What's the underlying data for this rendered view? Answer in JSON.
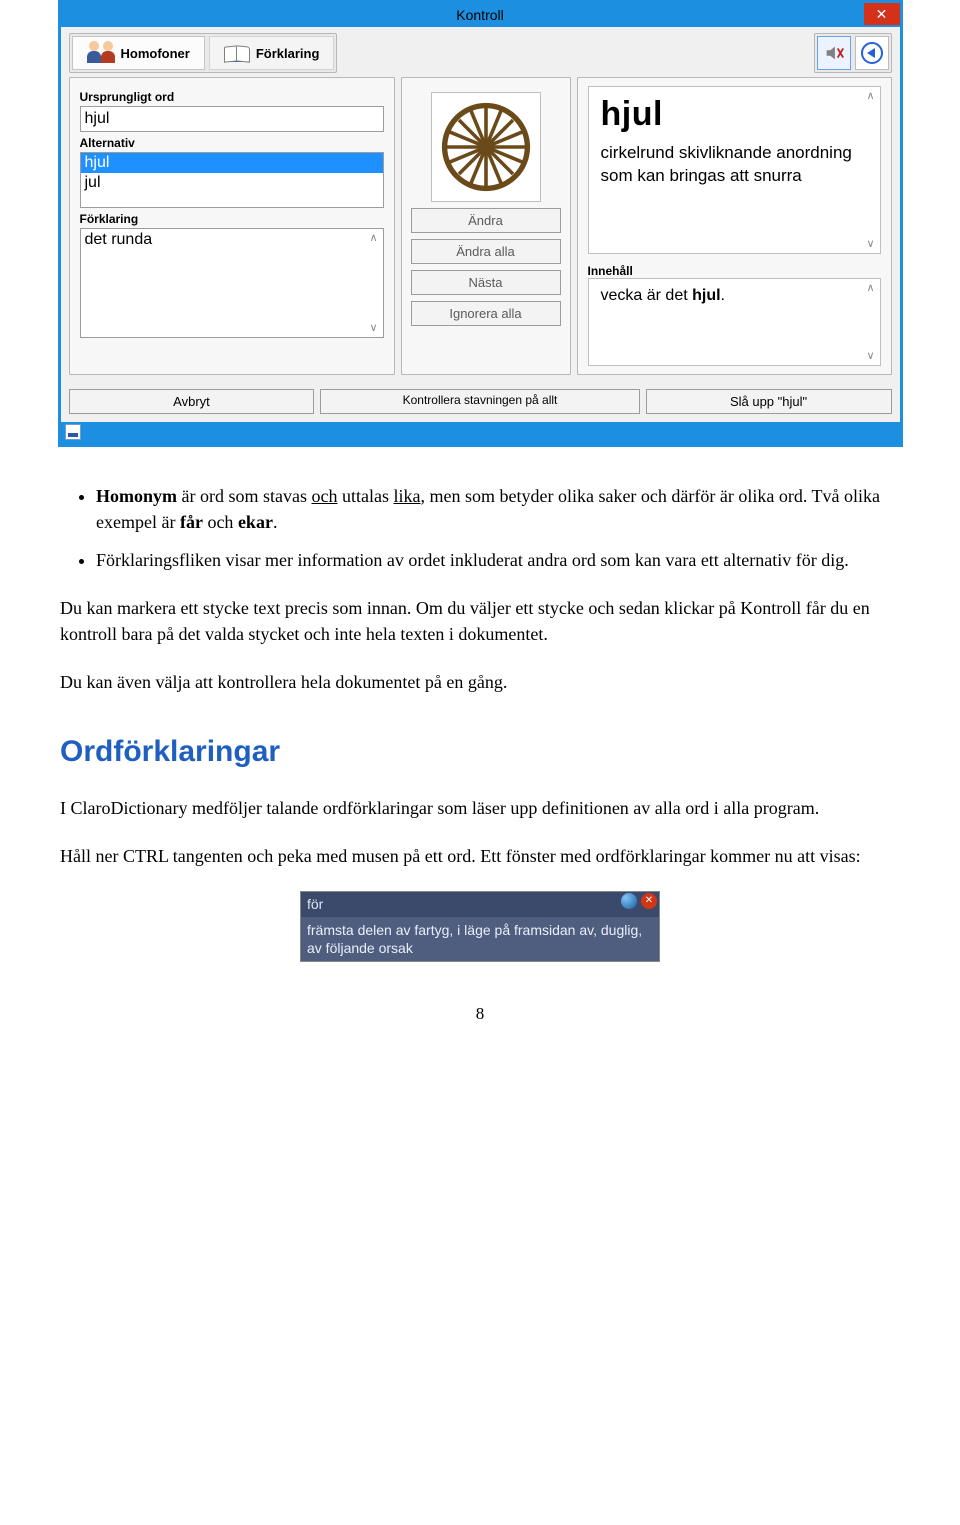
{
  "dialog": {
    "title": "Kontroll",
    "tabs": {
      "homofoner": "Homofoner",
      "forklaring": "Förklaring"
    },
    "labels": {
      "ursprungligt": "Ursprungligt ord",
      "alternativ": "Alternativ",
      "forklaring": "Förklaring",
      "innehall": "Innehåll"
    },
    "ursprungligt_value": "hjul",
    "alternativ": [
      "hjul",
      "jul"
    ],
    "alternativ_selected": "hjul",
    "forklaring_value": "det runda",
    "buttons": {
      "andra": "Ändra",
      "andra_alla": "Ändra alla",
      "nasta": "Nästa",
      "ignorera_alla": "Ignorera alla",
      "avbryt": "Avbryt",
      "kontrollera": "Kontrollera stavningen på allt",
      "sla_upp": "Slå upp \"hjul\""
    },
    "definition": {
      "word": "hjul",
      "text": "cirkelrund skivliknande anordning som kan bringas att snurra"
    },
    "context_prefix": "vecka är det ",
    "context_bold": "hjul",
    "context_suffix": "."
  },
  "doc": {
    "bullet1_a": "Homonym",
    "bullet1_b": " är ord som stavas ",
    "bullet1_c": "och",
    "bullet1_d": " uttalas ",
    "bullet1_e": "lika",
    "bullet1_f": ", men som betyder olika saker och därför är olika ord. Två olika exempel är ",
    "bullet1_g": "får",
    "bullet1_h": " och ",
    "bullet1_i": "ekar",
    "bullet1_j": ".",
    "bullet2": "Förklaringsfliken visar mer information av ordet inkluderat andra ord som kan vara ett alternativ för dig.",
    "p1": "Du kan markera ett stycke text precis som innan. Om du väljer ett stycke och sedan klickar på Kontroll får du en kontroll bara på det valda stycket och inte hela texten i dokumentet.",
    "p2": "Du kan även välja att kontrollera hela dokumentet på en gång.",
    "h2": "Ordförklaringar",
    "p3": "I ClaroDictionary medföljer talande ordförklaringar som läser upp definitionen av alla ord i alla program.",
    "p4": "Håll ner CTRL tangenten och peka med musen på ett ord. Ett fönster med ordförklaringar kommer nu att visas:"
  },
  "tooltip": {
    "word": "för",
    "body": "främsta delen av fartyg, i läge på framsidan av, duglig, av följande orsak"
  },
  "page_number": "8"
}
